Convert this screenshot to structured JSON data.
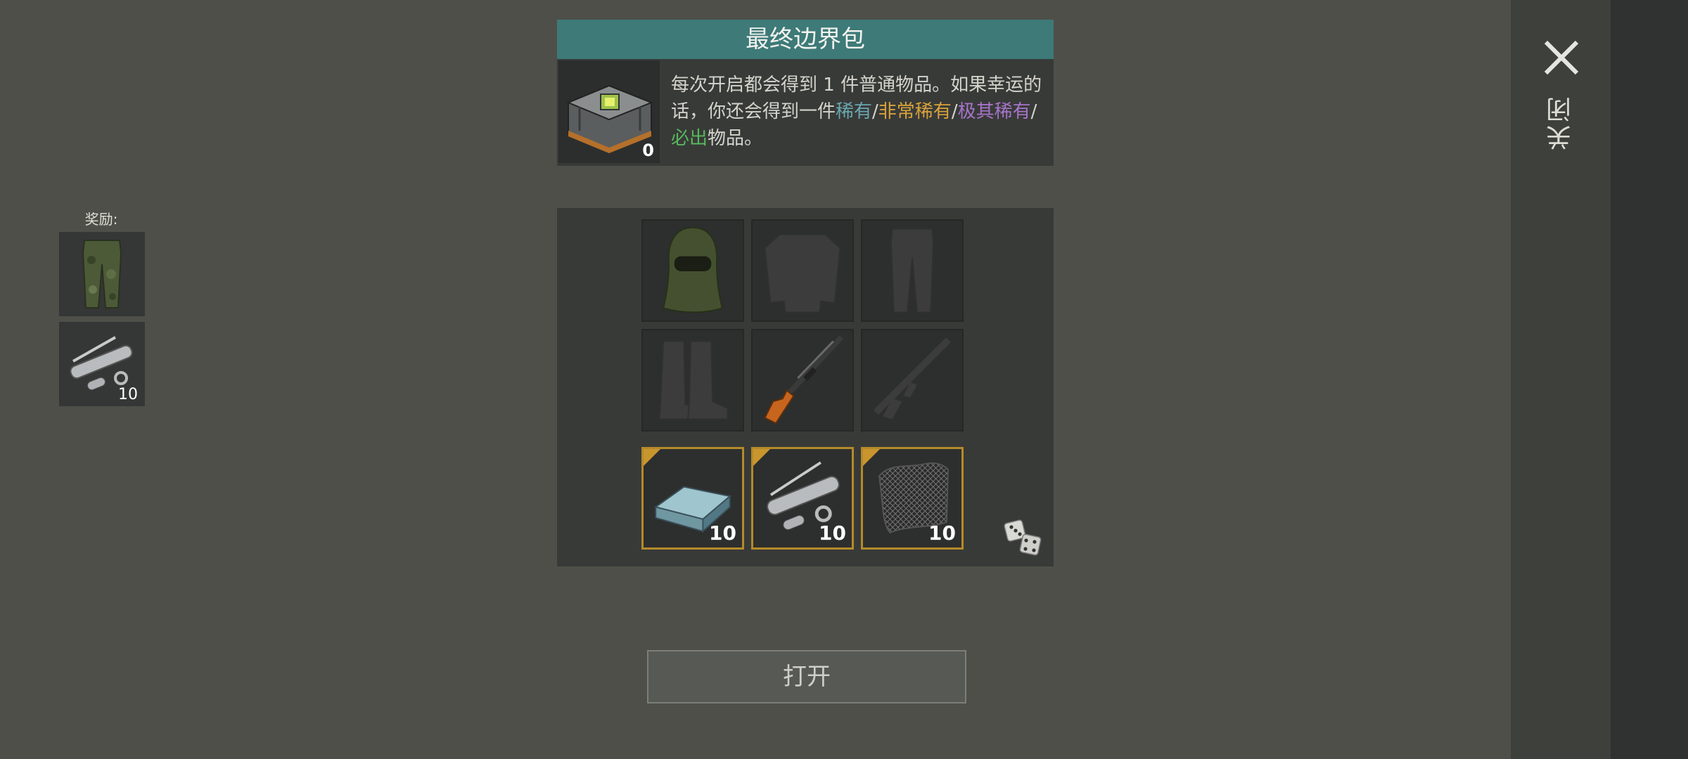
{
  "header": {
    "title": "最终边界包"
  },
  "pack": {
    "count": "0",
    "description": {
      "p1": "每次开启都会得到 1 件普通物品。如果幸运的话，你还会得到一件",
      "rare": "稀有",
      "sep1": "/",
      "very_rare": "非常稀有",
      "sep2": "/",
      "extremely_rare": "极其稀有",
      "sep3": "/",
      "guaranteed": "必出",
      "p2": "物品。"
    }
  },
  "rewards": {
    "label": "奖励:",
    "items": [
      {
        "icon": "camo-pants-icon",
        "qty": ""
      },
      {
        "icon": "gun-parts-icon",
        "qty": "10"
      }
    ]
  },
  "grid": {
    "items": [
      {
        "icon": "balaclava-icon",
        "qty": "",
        "dimmed": false
      },
      {
        "icon": "camo-jacket-icon",
        "qty": "",
        "dimmed": true
      },
      {
        "icon": "camo-pants-icon",
        "qty": "",
        "dimmed": true
      },
      {
        "icon": "boots-icon",
        "qty": "",
        "dimmed": true
      },
      {
        "icon": "sniper-rifle-icon",
        "qty": "",
        "dimmed": false
      },
      {
        "icon": "assault-rifle-icon",
        "qty": "",
        "dimmed": true
      },
      {
        "icon": "metal-ingot-icon",
        "qty": "10",
        "dimmed": false
      },
      {
        "icon": "gun-parts-icon",
        "qty": "10",
        "dimmed": false
      },
      {
        "icon": "mesh-fabric-icon",
        "qty": "10",
        "dimmed": false
      }
    ]
  },
  "open_button": {
    "label": "打开"
  },
  "close": {
    "label": "关闭"
  },
  "colors": {
    "background": "#4e4f48",
    "header_teal": "#3d7a78",
    "rare": "#6aa7b0",
    "very_rare": "#d9a23a",
    "extremely_rare": "#a774c9",
    "guaranteed": "#58b85c",
    "gold_border": "#b58a2a"
  }
}
